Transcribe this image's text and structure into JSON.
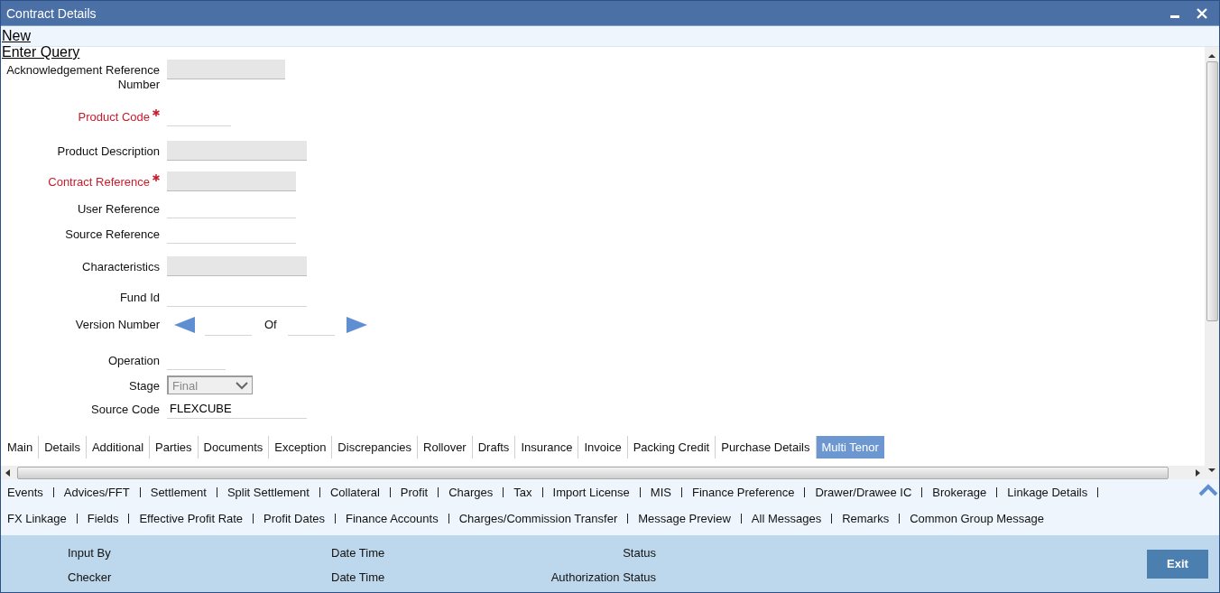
{
  "window": {
    "title": "Contract Details"
  },
  "toolbar": [
    {
      "label": "New"
    },
    {
      "label": "Enter Query"
    }
  ],
  "fields": [
    {
      "kind": "text",
      "label": "Acknowledgement Reference Number",
      "required": false,
      "readonly": true
    },
    {
      "kind": "text",
      "label": "Product Code",
      "required": true,
      "readonly": false
    },
    {
      "kind": "text",
      "label": "Product Description",
      "required": false,
      "readonly": true
    },
    {
      "kind": "text",
      "label": "Contract Reference",
      "required": true,
      "readonly": true
    },
    {
      "kind": "text",
      "label": "User Reference",
      "required": false,
      "readonly": false
    },
    {
      "kind": "text",
      "label": "Source Reference",
      "required": false,
      "readonly": false
    },
    {
      "kind": "text",
      "label": "Characteristics",
      "required": false,
      "readonly": true
    },
    {
      "kind": "text",
      "label": "Fund Id",
      "required": false,
      "readonly": false
    },
    {
      "kind": "version",
      "label": "Version Number",
      "of_label": "Of"
    },
    {
      "kind": "text",
      "label": "Operation",
      "required": false,
      "readonly": false
    },
    {
      "kind": "select",
      "label": "Stage",
      "disabled": true,
      "value": "Final"
    },
    {
      "kind": "text",
      "label": "Source Code",
      "required": false,
      "readonly": false,
      "value": "FLEXCUBE"
    }
  ],
  "tabs": [
    {
      "label": "Main",
      "selected": false
    },
    {
      "label": "Details",
      "selected": false
    },
    {
      "label": "Additional",
      "selected": false
    },
    {
      "label": "Parties",
      "selected": false
    },
    {
      "label": "Documents",
      "selected": false
    },
    {
      "label": "Exception",
      "selected": false
    },
    {
      "label": "Discrepancies",
      "selected": false
    },
    {
      "label": "Rollover",
      "selected": false
    },
    {
      "label": "Drafts",
      "selected": false
    },
    {
      "label": "Insurance",
      "selected": false
    },
    {
      "label": "Invoice",
      "selected": false
    },
    {
      "label": "Packing Credit",
      "selected": false
    },
    {
      "label": "Purchase Details",
      "selected": false
    },
    {
      "label": "Multi Tenor",
      "selected": true
    }
  ],
  "links": [
    [
      "Events",
      "Advices/FFT",
      "Settlement",
      "Split Settlement",
      "Collateral",
      "Profit",
      "Charges",
      "Tax",
      "Import License",
      "MIS",
      "Finance Preference",
      "Drawer/Drawee IC",
      "Brokerage",
      "Linkage Details"
    ],
    [
      "FX Linkage",
      "Fields",
      "Effective Profit Rate",
      "Profit Dates",
      "Finance Accounts",
      "Charges/Commission Transfer",
      "Message Preview",
      "All Messages",
      "Remarks",
      "Common Group Message"
    ]
  ],
  "footer": {
    "rows": [
      [
        "Input By",
        "Date Time",
        "Status"
      ],
      [
        "Checker",
        "Date Time",
        "Authorization Status"
      ]
    ],
    "exit_button": "Exit"
  }
}
